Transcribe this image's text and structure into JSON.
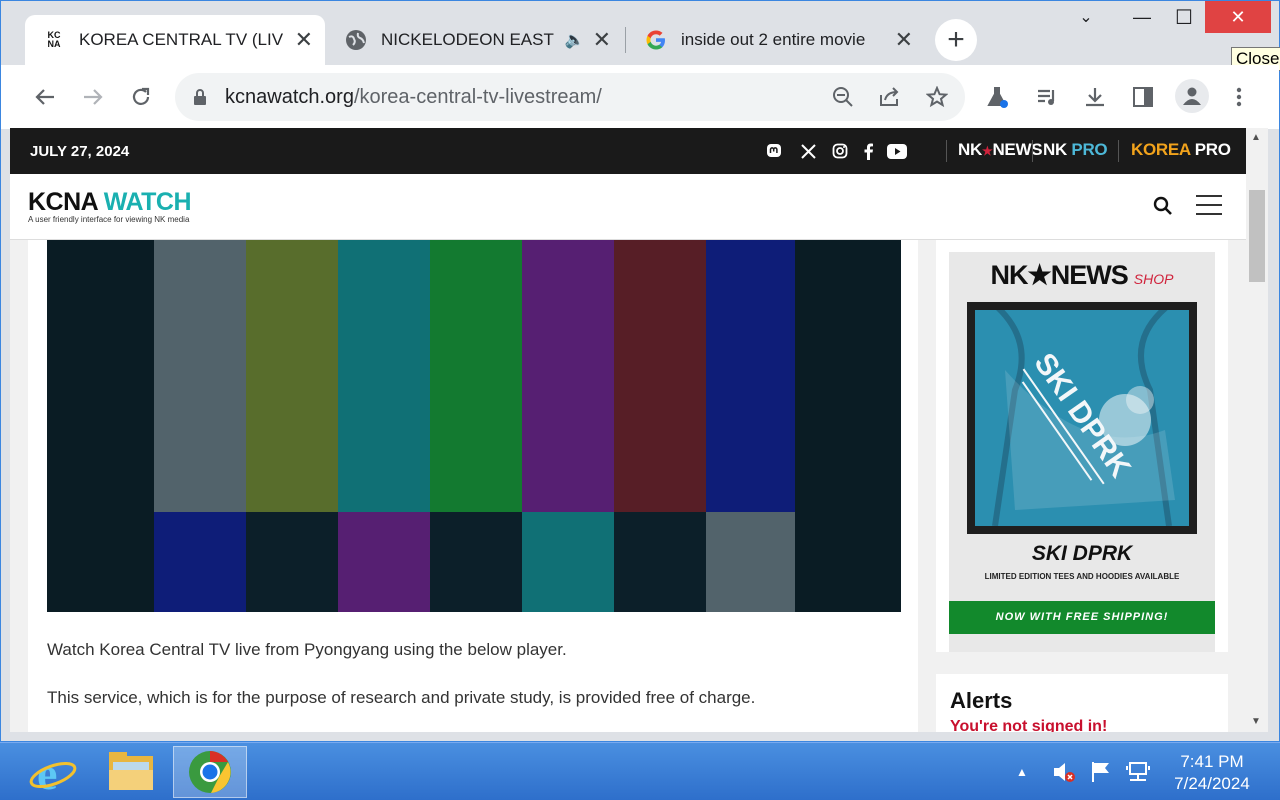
{
  "browser": {
    "tabs": [
      {
        "title": "KOREA CENTRAL TV (LIV",
        "favicon_text": "KC NA",
        "active": true
      },
      {
        "title": "NICKELODEON EAST",
        "favicon": "globe-icon",
        "audio": true,
        "active": false
      },
      {
        "title": "inside out 2 entire movie",
        "favicon": "google-icon",
        "active": false
      }
    ],
    "window_controls": {
      "minimize": "—",
      "maximize": "☐",
      "close": "✕"
    },
    "tooltip": "Close",
    "url_domain": "kcnawatch.org",
    "url_path": "/korea-central-tv-livestream/"
  },
  "site": {
    "date": "JULY 27, 2024",
    "brands": [
      {
        "part1": "NK",
        "part2": "NEWS",
        "part2_color": "#ffffff"
      },
      {
        "part1": "NK",
        "part2": "PRO",
        "part2_color": "#4db8d8"
      },
      {
        "part1": "KOREA",
        "part2": "PRO",
        "part1_color": "#f2a31c"
      }
    ],
    "logo_part1": "KCNA",
    "logo_part2": "WATCH",
    "tagline": "A user friendly interface for viewing NK media",
    "paragraphs": [
      "Watch Korea Central TV live from Pyongyang using the below player.",
      "This service, which is for the purpose of research and private study, is provided free of charge."
    ],
    "ad": {
      "brand": "NK★NEWS",
      "shop": "SHOP",
      "shirt_text": "SKI DPRK",
      "title": "SKI DPRK",
      "subtitle": "LIMITED EDITION TEES AND HOODIES AVAILABLE",
      "cta": "NOW WITH FREE SHIPPING!"
    },
    "alerts": {
      "heading": "Alerts",
      "message": "You're not signed in!"
    }
  },
  "taskbar": {
    "time": "7:41 PM",
    "date": "7/24/2024"
  },
  "colors": {
    "accent_teal": "#1ab0b0",
    "cta_green": "#12892c",
    "alert_red": "#c8102e",
    "close_red": "#e04343"
  }
}
